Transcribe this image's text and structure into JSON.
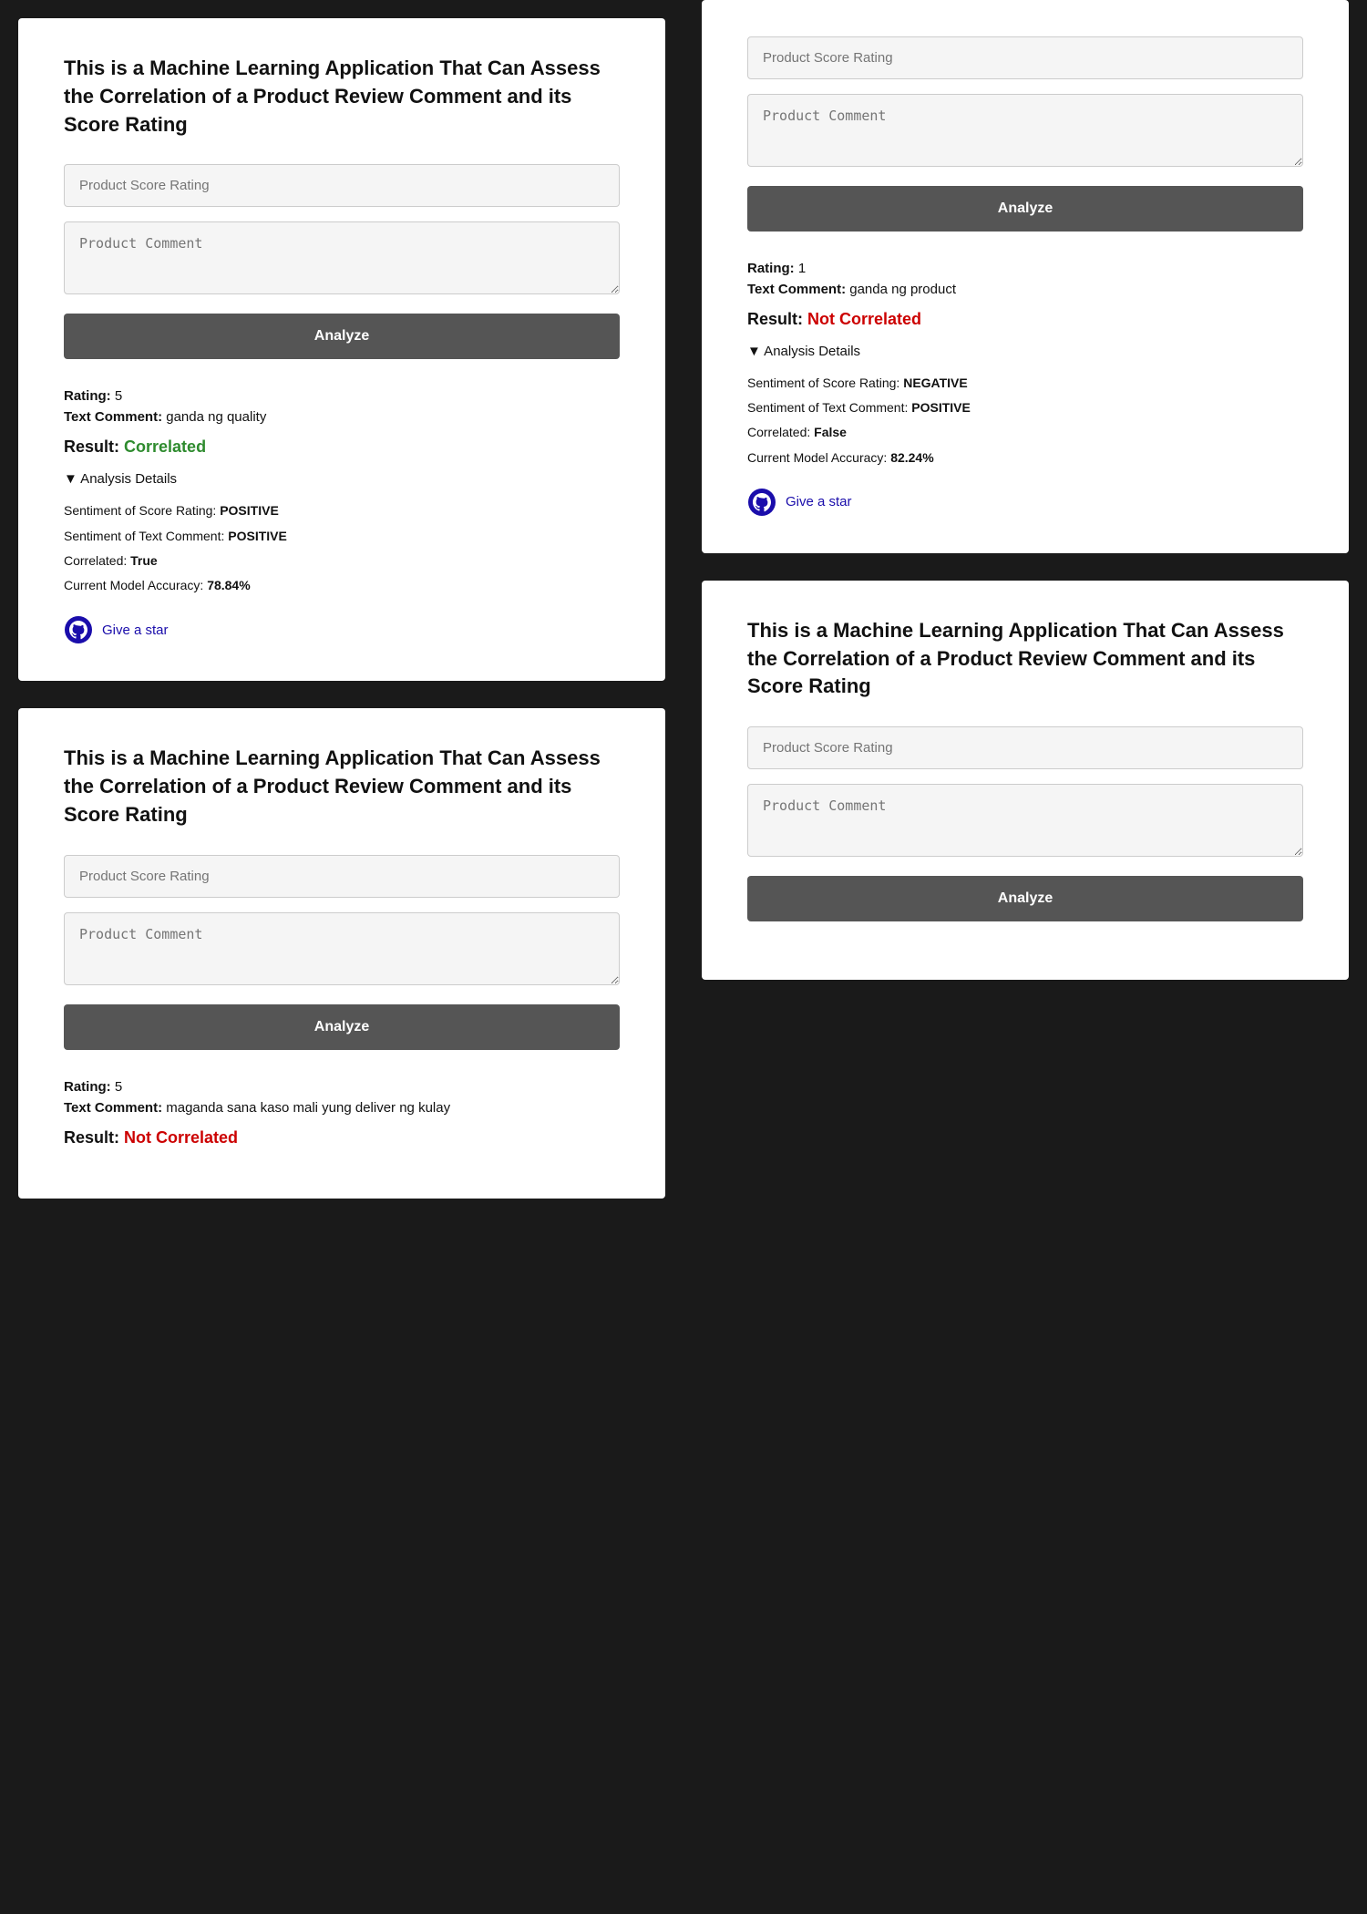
{
  "cards": [
    {
      "id": "card-1-left",
      "title": "This is a Machine Learning Application That Can Assess the Correlation of a Product Review Comment and its Score Rating",
      "rating_placeholder": "Product Score Rating",
      "comment_placeholder": "Product Comment",
      "analyze_label": "Analyze",
      "rating_value": "5",
      "text_comment": "ganda ng quality",
      "result_label": "Result:",
      "result_text": "Correlated",
      "result_type": "correlated",
      "analysis_toggle": "▼ Analysis Details",
      "sentiment_score": "POSITIVE",
      "sentiment_comment": "POSITIVE",
      "correlated": "True",
      "accuracy": "78.84%",
      "github_text": "Give a star"
    },
    {
      "id": "card-2-left",
      "title": "This is a Machine Learning Application That Can Assess the Correlation of a Product Review Comment and its Score Rating",
      "rating_placeholder": "Product Score Rating",
      "comment_placeholder": "Product Comment",
      "analyze_label": "Analyze",
      "rating_value": "5",
      "text_comment": "maganda sana kaso mali yung deliver ng kulay",
      "result_label": "Result:",
      "result_text": "Not Correlated",
      "result_type": "not-correlated",
      "show_result": true,
      "partial": true
    }
  ],
  "cards_right": [
    {
      "id": "card-1-right",
      "rating_placeholder": "Product Score Rating",
      "comment_placeholder": "Product Comment",
      "analyze_label": "Analyze",
      "rating_value": "1",
      "text_comment": "ganda ng product",
      "result_label": "Result:",
      "result_text": "Not Correlated",
      "result_type": "not-correlated",
      "analysis_toggle": "▼ Analysis Details",
      "sentiment_score": "NEGATIVE",
      "sentiment_comment": "POSITIVE",
      "correlated": "False",
      "accuracy": "82.24%",
      "github_text": "Give a star"
    },
    {
      "id": "card-2-right",
      "title": "This is a Machine Learning Application That Can Assess the Correlation of a Product Review Comment and its Score Rating",
      "rating_placeholder": "Product Score Rating",
      "comment_placeholder": "Product Comment",
      "analyze_label": "Analyze"
    }
  ],
  "labels": {
    "rating": "Rating:",
    "text_comment": "Text Comment:",
    "sentiment_score_label": "Sentiment of Score Rating:",
    "sentiment_comment_label": "Sentiment of Text Comment:",
    "correlated_label": "Correlated:",
    "accuracy_label": "Current Model Accuracy:"
  }
}
